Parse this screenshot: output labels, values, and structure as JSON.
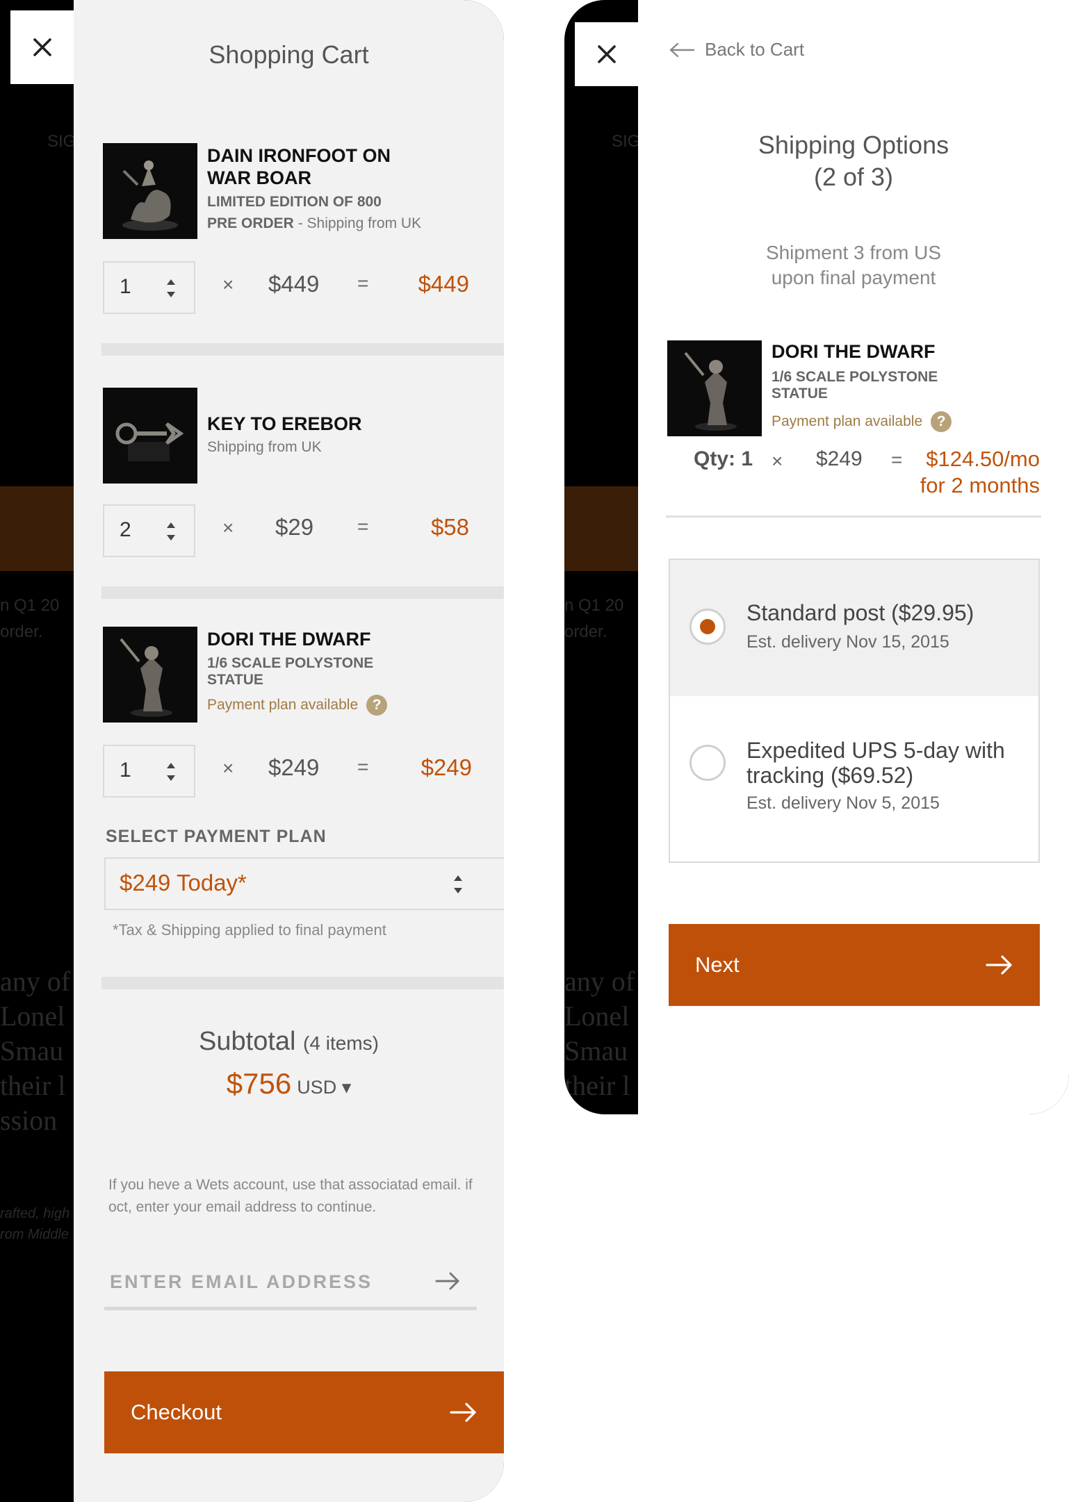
{
  "colors": {
    "accent": "#c0530a",
    "button": "#bf500a",
    "panel": "#f2f2f2"
  },
  "cart": {
    "title": "Shopping Cart",
    "items": [
      {
        "name_line1": "DAIN IRONFOOT ON",
        "name_line2": "WAR BOAR",
        "subtitle": "LIMITED EDITION OF 800",
        "shipping_prefix": "PRE ORDER",
        "shipping": " - Shipping from UK",
        "qty": "1",
        "op_times": "×",
        "price": "$449",
        "op_equals": "=",
        "total": "$449",
        "remove_icon": "close-icon"
      },
      {
        "name_line1": "KEY TO EREBOR",
        "shipping": "Shipping from UK",
        "qty": "2",
        "op_times": "×",
        "price": "$29",
        "op_equals": "=",
        "total": "$58",
        "remove_icon": "close-icon"
      },
      {
        "name_line1": "DORI THE DWARF",
        "sub_line1": "1/6 SCALE POLYSTONE",
        "sub_line2": "STATUE",
        "plan": "Payment plan available",
        "help": "?",
        "qty": "1",
        "op_times": "×",
        "price": "$249",
        "op_equals": "=",
        "total": "$249",
        "remove_icon": "close-icon"
      }
    ],
    "payment_plan_label": "SELECT PAYMENT PLAN",
    "payment_plan_value": "$249 Today*",
    "tax_note": "*Tax & Shipping applied to final payment",
    "subtotal_label": "Subtotal",
    "subtotal_items": "(4 items)",
    "subtotal_amount": "$756",
    "currency": "USD ▾",
    "email_note": "If you heve a Wets account, use that associatad email. if oct, enter your email address to continue.",
    "email_placeholder": "ENTER EMAIL ADDRESS",
    "checkout_label": "Checkout"
  },
  "shipping": {
    "back_label": "Back to Cart",
    "title_line1": "Shipping Options",
    "title_line2": "(2 of 3)",
    "shipment_line1": "Shipment 3 from US",
    "shipment_line2": "upon final payment",
    "item": {
      "name": "DORI THE DWARF",
      "sub_line1": "1/6 SCALE POLYSTONE",
      "sub_line2": "STATUE",
      "plan": "Payment plan available",
      "help": "?",
      "qty_label": "Qty: 1",
      "op_times": "×",
      "price": "$249",
      "op_equals": "=",
      "total_line1": "$124.50/mo",
      "total_line2": "for 2 months"
    },
    "options": [
      {
        "title": "Standard post ($29.95)",
        "delivery": "Est. delivery Nov 15, 2015",
        "selected": true
      },
      {
        "title_line1": "Expedited UPS 5-day with",
        "title_line2": "tracking ($69.52)",
        "delivery": "Est. delivery Nov 5, 2015",
        "selected": false
      }
    ],
    "next_label": "Next"
  },
  "background": {
    "texts1": [
      "SIG",
      "n Q1 20",
      "order.",
      "any of",
      "Lonel",
      "Smau",
      "their l",
      "ssion",
      "rafted, high",
      "rom Middle"
    ],
    "texts2": [
      "SIG",
      "n Q1 20",
      "order.",
      "any of",
      "Lonel",
      "Smau",
      "their l"
    ]
  }
}
